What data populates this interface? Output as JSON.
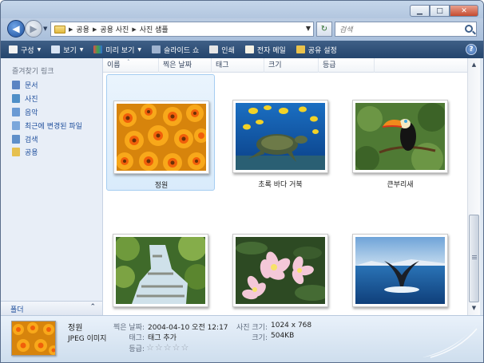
{
  "window": {
    "caption_buttons": [
      "minimize",
      "maximize",
      "close"
    ]
  },
  "address": {
    "crumbs": [
      "공용",
      "공용 사진",
      "사진 샘플"
    ],
    "search_placeholder": "검색"
  },
  "toolbar": {
    "organize": "구성",
    "view": "보기",
    "preview": "미리 보기",
    "slideshow": "슬라이드 쇼",
    "print": "인쇄",
    "email": "전자 메일",
    "share": "공유 설정",
    "help": "?"
  },
  "nav": {
    "title": "즐겨찾기 링크",
    "items": [
      {
        "label": "문서",
        "icon": "documents-icon"
      },
      {
        "label": "사진",
        "icon": "pictures-icon"
      },
      {
        "label": "음악",
        "icon": "music-icon"
      },
      {
        "label": "최근에 변경된 파일",
        "icon": "recent-icon"
      },
      {
        "label": "검색",
        "icon": "search-folder-icon"
      },
      {
        "label": "공용",
        "icon": "public-folder-icon"
      }
    ],
    "folders_label": "폴더"
  },
  "columns": [
    "이름",
    "찍은 날짜",
    "태그",
    "크기",
    "등급"
  ],
  "files": [
    {
      "name": "정원",
      "selected": true
    },
    {
      "name": "초록 바다 거북",
      "selected": false
    },
    {
      "name": "큰부리새",
      "selected": false
    },
    {
      "name": "",
      "selected": false
    },
    {
      "name": "",
      "selected": false
    },
    {
      "name": "",
      "selected": false
    }
  ],
  "details": {
    "name": "정원",
    "type": "JPEG 이미지",
    "date_label": "찍은 날짜:",
    "date_value": "2004-04-10 오전 12:17",
    "tags_label": "태그:",
    "tags_value": "태그 추가",
    "rating_label": "등급:",
    "rating": 0,
    "rating_max": 5,
    "dimensions_label": "사진 크기:",
    "dimensions_value": "1024 x 768",
    "size_label": "크기:",
    "size_value": "504KB"
  },
  "colors": {
    "accent": "#1f4f9c",
    "command_bar": "#24456d",
    "selection": "#d9ebfb"
  }
}
